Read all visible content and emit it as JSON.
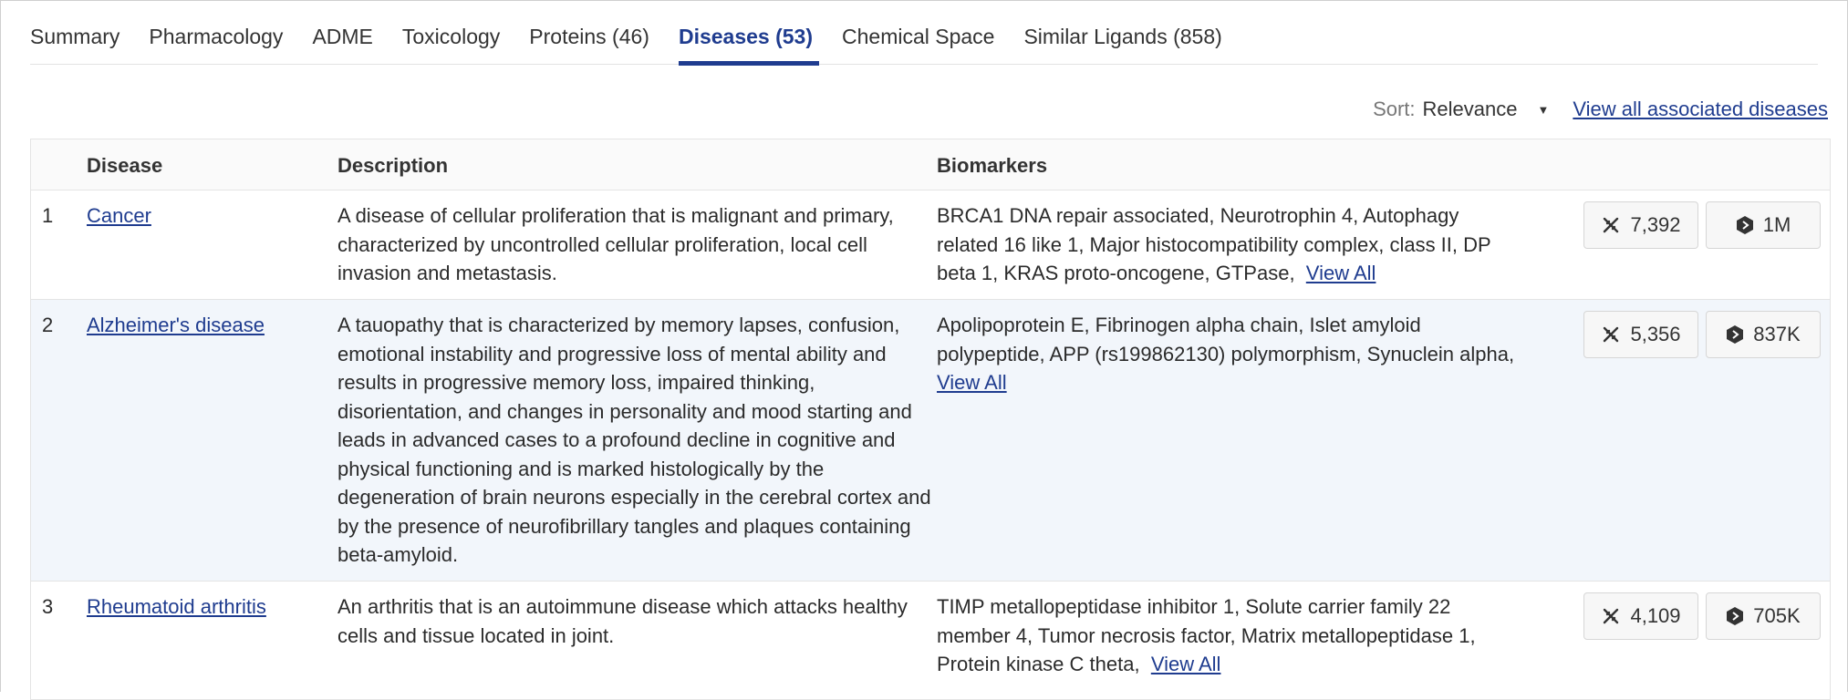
{
  "tabs": [
    {
      "label": "Summary"
    },
    {
      "label": "Pharmacology"
    },
    {
      "label": "ADME"
    },
    {
      "label": "Toxicology"
    },
    {
      "label": "Proteins (46)"
    },
    {
      "label": "Diseases (53)",
      "active": true
    },
    {
      "label": "Chemical Space"
    },
    {
      "label": "Similar Ligands (858)"
    }
  ],
  "sort": {
    "label": "Sort:",
    "value": "Relevance",
    "caret_icon": "caret-down-icon",
    "view_all_link": "View all associated diseases"
  },
  "table": {
    "headers": {
      "disease": "Disease",
      "description": "Description",
      "biomarkers": "Biomarkers"
    },
    "rows": [
      {
        "num": "1",
        "disease": "Cancer",
        "description": "A disease of cellular proliferation that is malignant and primary, characterized by uncontrolled cellular proliferation, local cell invasion and metastasis.",
        "biomarkers": "BRCA1 DNA repair associated,  Neurotrophin 4,  Autophagy related 16 like 1,  Major histocompatibility complex, class II, DP beta 1,  KRAS proto-oncogene, GTPase,",
        "view_all": "View All",
        "count1": "7,392",
        "count2": "1M"
      },
      {
        "num": "2",
        "disease": "Alzheimer's disease",
        "description": "A tauopathy that is characterized by memory lapses, confusion, emotional instability and progressive loss of mental ability and results in progressive memory loss, impaired thinking, disorientation, and changes in personality and mood starting and leads in advanced cases to a profound decline in cognitive and physical functioning and is marked histologically by the degeneration of brain neurons especially in the cerebral cortex and by the presence of neurofibrillary tangles and plaques containing beta-amyloid.",
        "biomarkers": "Apolipoprotein E,  Fibrinogen alpha chain,  Islet amyloid polypeptide,  APP (rs199862130) polymorphism,  Synuclein alpha,",
        "view_all": "View All",
        "count1": "5,356",
        "count2": "837K"
      },
      {
        "num": "3",
        "disease": "Rheumatoid arthritis",
        "description": "An arthritis that is an autoimmune disease which attacks healthy cells and tissue located in joint.",
        "biomarkers": "TIMP metallopeptidase inhibitor 1,  Solute carrier family 22 member 4,  Tumor necrosis factor,  Matrix metallopeptidase 1,  Protein kinase C theta,",
        "view_all": "View All",
        "count1": "4,109",
        "count2": "705K"
      }
    ]
  },
  "icons": {
    "badge1": "dna-icon",
    "badge2": "hexagon-molecule-icon"
  },
  "colors": {
    "accent": "#1f3c8f",
    "row_alt": "#f2f6fb"
  }
}
